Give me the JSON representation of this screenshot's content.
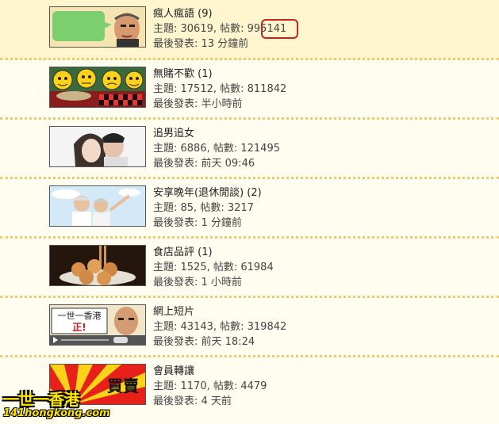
{
  "forums": [
    {
      "name": "瘋人瘋語",
      "new_count": "(9)",
      "stats": "主題: 30619, 帖數: 995141",
      "last_post": "最後發表: 13 分鐘前",
      "thumb": "green-speech-bubble-avatar"
    },
    {
      "name": "無賭不歡",
      "new_count": "(1)",
      "stats": "主題: 17512, 帖數: 811842",
      "last_post": "最後發表: 半小時前",
      "thumb": "smiley-faces-gambling"
    },
    {
      "name": "追男追女",
      "new_count": "",
      "stats": "主題: 6886, 帖數: 121495",
      "last_post": "最後發表: 前天 09:46",
      "thumb": "couple-photo"
    },
    {
      "name": "安享晚年(退休閒談)",
      "new_count": "(2)",
      "stats": "主題: 85, 帖數: 3217",
      "last_post": "最後發表: 1 分鐘前",
      "thumb": "elderly-couple-photo"
    },
    {
      "name": "食店品評",
      "new_count": "(1)",
      "stats": "主題: 1525, 帖數: 61984",
      "last_post": "最後發表: 1 小時前",
      "thumb": "food-photo"
    },
    {
      "name": "網上短片",
      "new_count": "",
      "stats": "主題: 43143, 帖數: 319842",
      "last_post": "最後發表: 前天 18:24",
      "thumb": "video-player-avatar",
      "thumb_text": "一世一香港",
      "thumb_text2": "正!"
    },
    {
      "name": "會員轉讓",
      "new_count": "",
      "stats": "主題: 1170, 帖數: 4479",
      "last_post": "最後發表: 4 天前",
      "thumb": "sunburst-buy-sell",
      "thumb_text": "買賣"
    }
  ],
  "watermark": {
    "line1": "一世一香港",
    "line2": "141hongkong.com"
  },
  "colors": {
    "background": "#fffcf0",
    "highlight_row": "#fff6d0",
    "count_color": "#c0662a",
    "divider": "#f0c96a",
    "annotation": "#d02020"
  }
}
